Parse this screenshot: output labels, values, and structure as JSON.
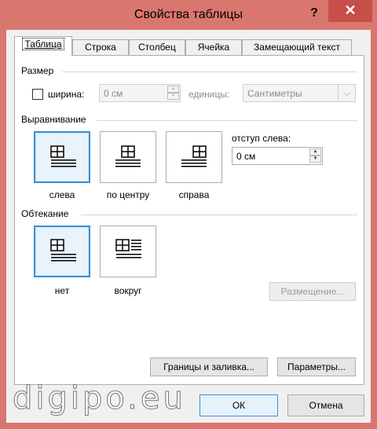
{
  "window": {
    "title": "Свойства таблицы",
    "help_label": "?",
    "close_label": "✕"
  },
  "tabs": [
    {
      "label": "Таблица",
      "active": true
    },
    {
      "label": "Строка",
      "active": false
    },
    {
      "label": "Столбец",
      "active": false
    },
    {
      "label": "Ячейка",
      "active": false
    },
    {
      "label": "Замещающий текст",
      "active": false
    }
  ],
  "size_group": {
    "label": "Размер",
    "width_checkbox_checked": false,
    "width_label": "ширина:",
    "width_value": "0 см",
    "units_label": "единицы:",
    "units_value": "Сантиметры"
  },
  "alignment_group": {
    "label": "Выравнивание",
    "options": [
      {
        "label": "слева",
        "selected": true,
        "icon": "table-align-left-icon"
      },
      {
        "label": "по центру",
        "selected": false,
        "icon": "table-align-center-icon"
      },
      {
        "label": "справа",
        "selected": false,
        "icon": "table-align-right-icon"
      }
    ],
    "indent_label": "отступ слева:",
    "indent_value": "0 см"
  },
  "wrap_group": {
    "label": "Обтекание",
    "options": [
      {
        "label": "нет",
        "selected": true,
        "icon": "wrap-none-icon"
      },
      {
        "label": "вокруг",
        "selected": false,
        "icon": "wrap-around-icon"
      }
    ],
    "positioning_button": "Размещение..."
  },
  "buttons": {
    "borders": "Границы и заливка...",
    "options": "Параметры...",
    "ok": "ОК",
    "cancel": "Отмена"
  },
  "watermark": "digipo.eu",
  "colors": {
    "titlebar": "#d9776f",
    "close_button": "#c74f4a",
    "selection_border": "#3c8fd2"
  }
}
